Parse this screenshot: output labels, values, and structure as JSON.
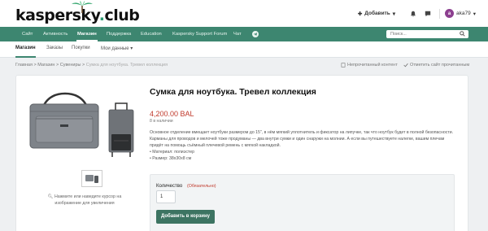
{
  "header": {
    "logo_text": "kaspersky",
    "logo_suffix": "club",
    "add_label": "Добавить",
    "username": "aka79",
    "avatar_letter": "a",
    "avatar_color": "#8c3f8f"
  },
  "nav": {
    "items": [
      "Сайт",
      "Активность",
      "Магазин",
      "Поддержка",
      "Education",
      "Kaspersky Support Forum",
      "Чат"
    ],
    "active": "Магазин",
    "search_placeholder": "Поиск...",
    "color": "#3d8670"
  },
  "subnav": {
    "items": [
      "Магазин",
      "Заказы",
      "Покупки",
      "Мои данные"
    ]
  },
  "breadcrumb": {
    "items": [
      "Главная",
      "Магазин",
      "Сувениры"
    ],
    "current": "Сумка для ноутбука. Тревел коллекция",
    "actions": [
      "Непрочитанный контент",
      "Отметить сайт прочитанным"
    ]
  },
  "product": {
    "title": "Сумка для ноутбука. Тревел коллекция",
    "price": "4,200.00 BAL",
    "stock": "8 в наличии",
    "description": "Основное отделение вмещает ноутбуки размером до 15\", в нём мягкий уплотнитель и фиксатор на липучке, так что ноутбук будет в полной безопасности. Карманы для проводов и мелочей тоже продуманы — два внутри сумки и один снаружи на молнии. А если вы путешествуете налегке, вашим плечам придёт на помощь съёмный плечевой ремень с мягкой накладкой.",
    "features": [
      "• Материал: полиэстер",
      "• Размер: 38х30х8 см"
    ],
    "zoom_hint": "Нажмите или наведите курсор на изображение для увеличения",
    "qty_label": "Количество",
    "qty_required": "(Обязательно)",
    "qty_value": "1",
    "add_to_cart": "Добавить в корзину"
  }
}
